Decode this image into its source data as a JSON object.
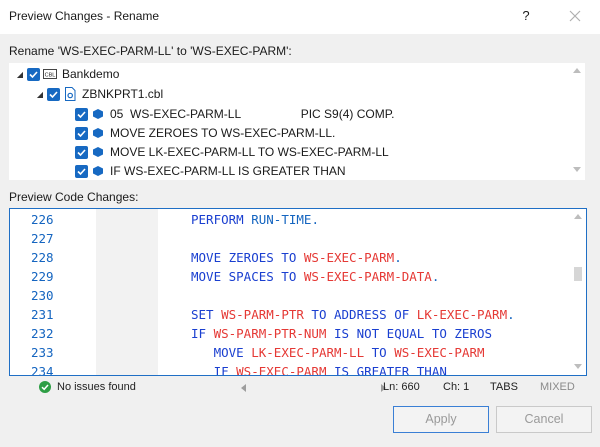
{
  "window": {
    "title": "Preview Changes - Rename",
    "help_label": "?"
  },
  "rename": {
    "label": "Rename 'WS-EXEC-PARM-LL' to 'WS-EXEC-PARM':",
    "tree": [
      {
        "text": "Bankdemo",
        "icon": "project-icon"
      },
      {
        "text": "ZBNKPRT1.cbl",
        "icon": "cobol-file-icon"
      },
      {
        "text": "05  WS-EXEC-PARM-LL                  PIC S9(4) COMP.",
        "icon": "change-icon"
      },
      {
        "text": "MOVE ZEROES TO WS-EXEC-PARM-LL.",
        "icon": "change-icon"
      },
      {
        "text": "MOVE LK-EXEC-PARM-LL TO WS-EXEC-PARM-LL",
        "icon": "change-icon"
      },
      {
        "text": "IF WS-EXEC-PARM-LL IS GREATER THAN",
        "icon": "change-icon"
      }
    ]
  },
  "preview": {
    "label": "Preview Code Changes:",
    "lines": [
      {
        "num": "226",
        "segments": [
          {
            "t": "PERFORM ",
            "c": "kw"
          },
          {
            "t": "RUN-TIME",
            "c": "plain"
          },
          {
            "t": ".",
            "c": "plain"
          }
        ]
      },
      {
        "num": "227",
        "segments": []
      },
      {
        "num": "228",
        "segments": [
          {
            "t": "MOVE ZEROES TO ",
            "c": "kw"
          },
          {
            "t": "WS-EXEC-PARM",
            "c": "id"
          },
          {
            "t": ".",
            "c": "plain"
          }
        ]
      },
      {
        "num": "229",
        "segments": [
          {
            "t": "MOVE SPACES TO ",
            "c": "kw"
          },
          {
            "t": "WS-EXEC-PARM-DATA",
            "c": "id"
          },
          {
            "t": ".",
            "c": "plain"
          }
        ]
      },
      {
        "num": "230",
        "segments": []
      },
      {
        "num": "231",
        "segments": [
          {
            "t": "SET ",
            "c": "kw"
          },
          {
            "t": "WS-PARM-PTR",
            "c": "id"
          },
          {
            "t": " TO ADDRESS OF ",
            "c": "kw"
          },
          {
            "t": "LK-EXEC-PARM",
            "c": "id"
          },
          {
            "t": ".",
            "c": "plain"
          }
        ]
      },
      {
        "num": "232",
        "segments": [
          {
            "t": "IF ",
            "c": "kw"
          },
          {
            "t": "WS-PARM-PTR-NUM",
            "c": "id"
          },
          {
            "t": " IS NOT EQUAL TO ZEROS",
            "c": "kw"
          }
        ]
      },
      {
        "num": "233",
        "segments": [
          {
            "t": "   MOVE ",
            "c": "kw"
          },
          {
            "t": "LK-EXEC-PARM-LL",
            "c": "id"
          },
          {
            "t": " TO ",
            "c": "kw"
          },
          {
            "t": "WS-EXEC-PARM",
            "c": "id"
          }
        ]
      },
      {
        "num": "234",
        "segments": [
          {
            "t": "   IF ",
            "c": "kw"
          },
          {
            "t": "WS-EXEC-PARM",
            "c": "id"
          },
          {
            "t": " IS GREATER THAN",
            "c": "kw"
          }
        ]
      }
    ]
  },
  "status": {
    "issues": "No issues found",
    "ln": "Ln: 660",
    "ch": "Ch: 1",
    "tabs": "TABS",
    "mixed": "MIXED"
  },
  "buttons": {
    "apply": "Apply",
    "cancel": "Cancel"
  },
  "colors": {
    "accent": "#1769c2",
    "code_keyword": "#1a3fd0",
    "code_identifier": "#e53935",
    "line_number": "#1565c0",
    "ok": "#2e9e45"
  }
}
